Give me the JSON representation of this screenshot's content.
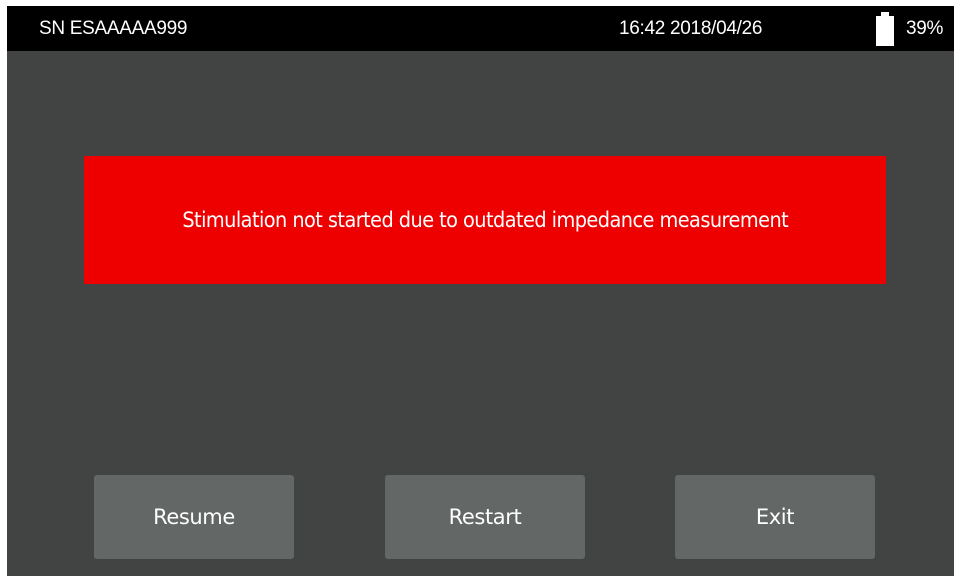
{
  "status_bar": {
    "serial_number": "SN ESAAAAA999",
    "datetime": "16:42 2018/04/26",
    "battery_icon": "battery-icon",
    "battery_percent": "39%",
    "battery_level": 0.39
  },
  "alert": {
    "message": "Stimulation not started due to outdated impedance measurement",
    "color": "#ee0000"
  },
  "buttons": {
    "resume_label": "Resume",
    "restart_label": "Restart",
    "exit_label": "Exit"
  }
}
